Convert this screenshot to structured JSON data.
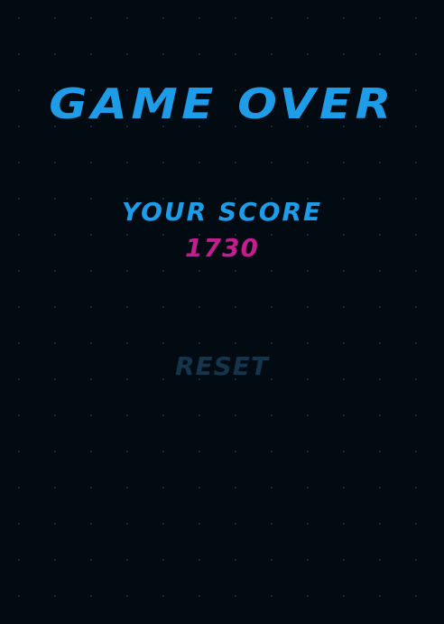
{
  "game_over": {
    "title": "GAME OVER",
    "score_label": "YOUR SCORE",
    "score_value": "1730",
    "reset_label": "RESET"
  },
  "colors": {
    "background": "#020a12",
    "title": "#1e9ce8",
    "score_value": "#c21e8e",
    "reset": "#14354b"
  }
}
